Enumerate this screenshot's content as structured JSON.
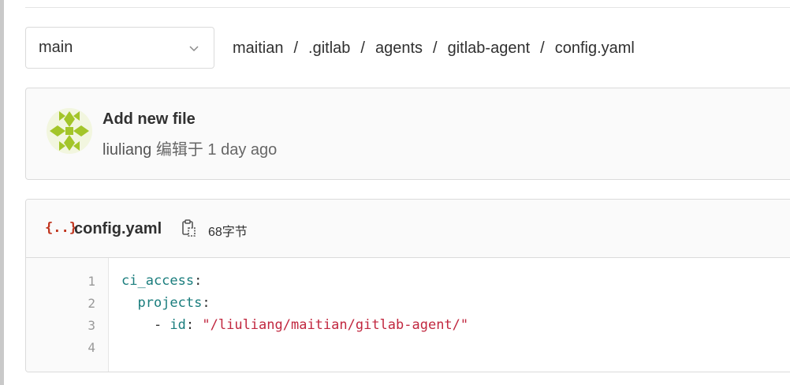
{
  "branch": {
    "selected": "main"
  },
  "breadcrumb": {
    "items": [
      "maitian",
      ".gitlab",
      "agents",
      "gitlab-agent",
      "config.yaml"
    ],
    "separator": "/"
  },
  "commit": {
    "title": "Add new file",
    "author": "liuliang",
    "action": "编辑于",
    "time": "1 day ago",
    "avatar_color": "#a3c529"
  },
  "file": {
    "icon": "{..}",
    "icon_name": "yaml-file-icon",
    "name": "config.yaml",
    "size": "68字节",
    "copy_icon": "copy-icon"
  },
  "code": {
    "line_numbers": [
      "1",
      "2",
      "3",
      "4"
    ],
    "lines": [
      {
        "indent": "",
        "key": "ci_access",
        "colon": ":",
        "value": ""
      },
      {
        "indent": "  ",
        "key": "projects",
        "colon": ":",
        "value": ""
      },
      {
        "indent": "    - ",
        "key": "id",
        "colon": ": ",
        "value": "\"/liuliang/maitian/gitlab-agent/\""
      },
      {
        "indent": "",
        "key": "",
        "colon": "",
        "value": ""
      }
    ]
  },
  "colors": {
    "key": "#1a7d7d",
    "string": "#c1273f",
    "file_icon": "#c0341d"
  }
}
